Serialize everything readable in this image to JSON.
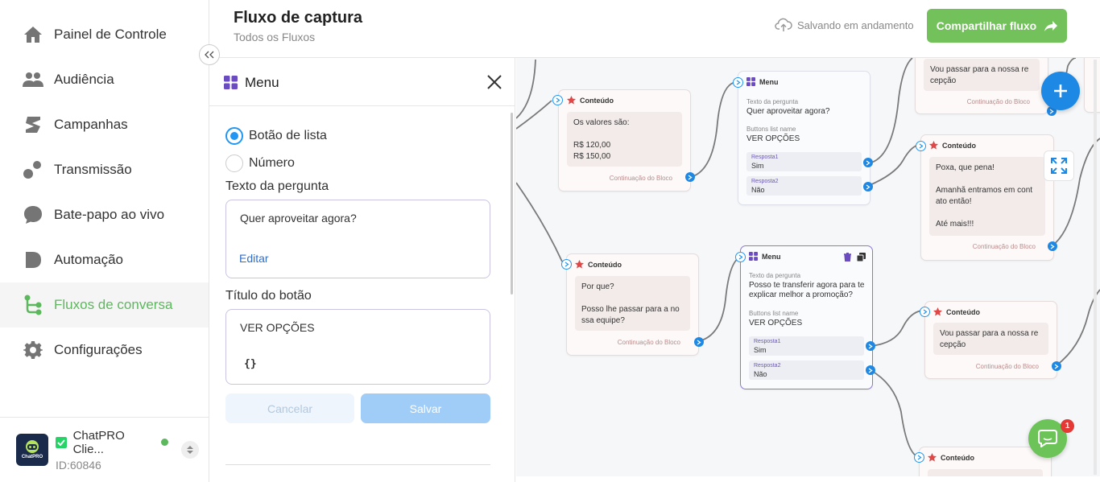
{
  "sidebar": {
    "items": [
      {
        "label": "Painel de Controle",
        "icon": "home-icon"
      },
      {
        "label": "Audiência",
        "icon": "users-icon"
      },
      {
        "label": "Campanhas",
        "icon": "campaign-icon"
      },
      {
        "label": "Transmissão",
        "icon": "broadcast-icon"
      },
      {
        "label": "Bate-papo ao vivo",
        "icon": "chat-bubble-icon"
      },
      {
        "label": "Automação",
        "icon": "automation-icon"
      },
      {
        "label": "Fluxos de conversa",
        "icon": "flow-icon",
        "active": true
      },
      {
        "label": "Configurações",
        "icon": "gear-icon"
      }
    ],
    "account": {
      "name": "ChatPRO Clie...",
      "id": "ID:60846",
      "avatar_text": "ChatPRO",
      "status_color": "#5cb85c"
    }
  },
  "header": {
    "title": "Fluxo de captura",
    "breadcrumb": "Todos os Fluxos",
    "save_status": "Salvando em andamento",
    "share_label": "Compartilhar fluxo"
  },
  "panel": {
    "title": "Menu",
    "radio_list": "Botão de lista",
    "radio_number": "Número",
    "question_label": "Texto da pergunta",
    "question_value": "Quer aproveitar agora?",
    "edit_label": "Editar",
    "button_title_label": "Título do botão",
    "button_title_value": "VER OPÇÕES",
    "variables_label": "{}",
    "cancel_label": "Cancelar",
    "save_label": "Salvar"
  },
  "canvas": {
    "common": {
      "content_header": "Conteúdo",
      "menu_header": "Menu",
      "continuation": "Continuação do Bloco",
      "question_sub": "Texto da pergunta",
      "buttons_sub": "Buttons list name",
      "answer1": "Resposta1",
      "answer2": "Resposta2",
      "yes": "Sim",
      "no": "Não"
    },
    "node1": {
      "body": "Os valores são:\n\nR$ 120,00\nR$ 150,00"
    },
    "node2": {
      "question": "Quer aproveitar agora?",
      "buttons": "VER OPÇÕES"
    },
    "node3": {
      "body": "Vou passar para a nossa re\ncepção"
    },
    "node4": {
      "body": "Poxa, que pena!\n\nAmanhã entramos em cont\nato então!\n\nAté mais!!!"
    },
    "node5": {
      "body": "Por que?\n\nPosso lhe passar para a no\nssa equipe?"
    },
    "node6": {
      "question": "Posso te transferir agora para te\nexplicar melhor a promoção?",
      "buttons": "VER OPÇÕES"
    },
    "node7": {
      "body": "Vou passar para a nossa re\ncepção"
    }
  },
  "chat_widget": {
    "badge": "1"
  },
  "colors": {
    "accent_green": "#72c15a",
    "primary_blue": "#1e88e5",
    "active_nav": "#5cb85c"
  }
}
